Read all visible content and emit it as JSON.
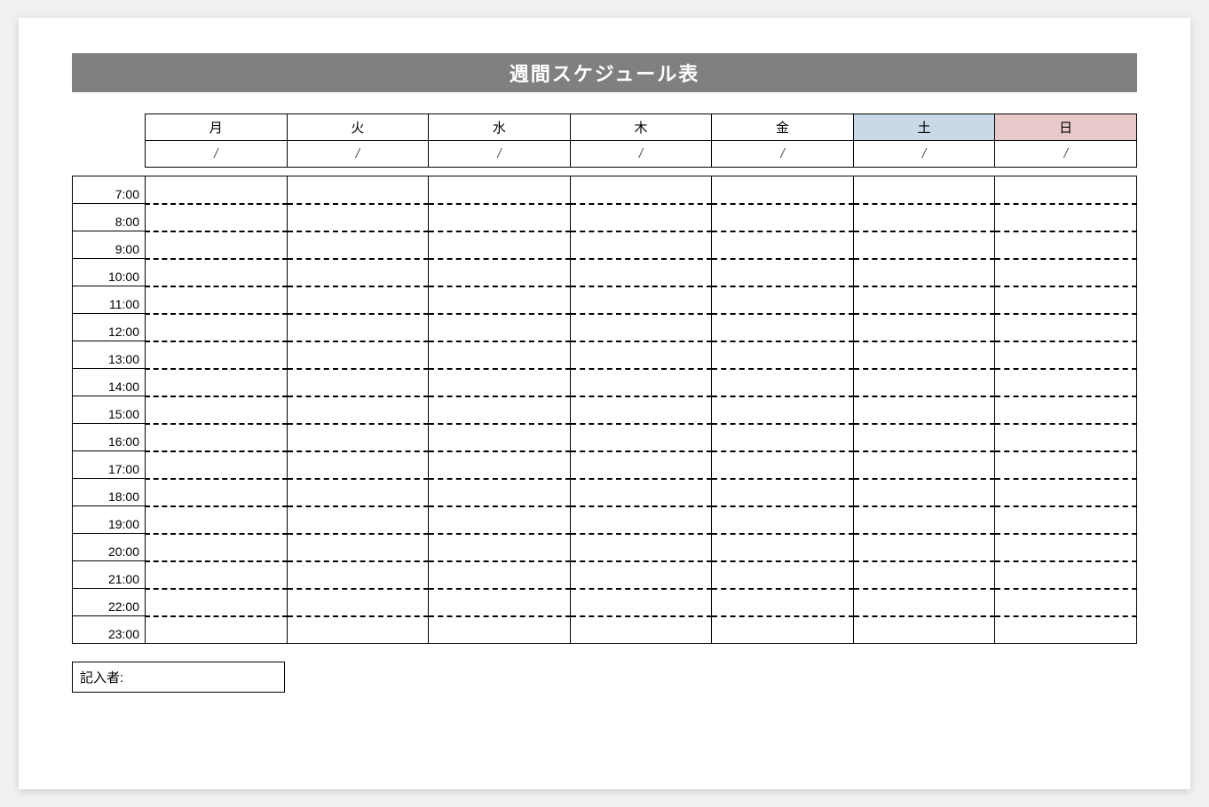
{
  "title": "週間スケジュール表",
  "days": [
    "月",
    "火",
    "水",
    "木",
    "金",
    "土",
    "日"
  ],
  "dates": [
    "/",
    "/",
    "/",
    "/",
    "/",
    "/",
    "/"
  ],
  "times": [
    "7:00",
    "8:00",
    "9:00",
    "10:00",
    "11:00",
    "12:00",
    "13:00",
    "14:00",
    "15:00",
    "16:00",
    "17:00",
    "18:00",
    "19:00",
    "20:00",
    "21:00",
    "22:00",
    "23:00"
  ],
  "author_label": "記入者:",
  "colors": {
    "header_bg": "#808080",
    "saturday_bg": "#c9d9e8",
    "sunday_bg": "#e8c9c9"
  }
}
